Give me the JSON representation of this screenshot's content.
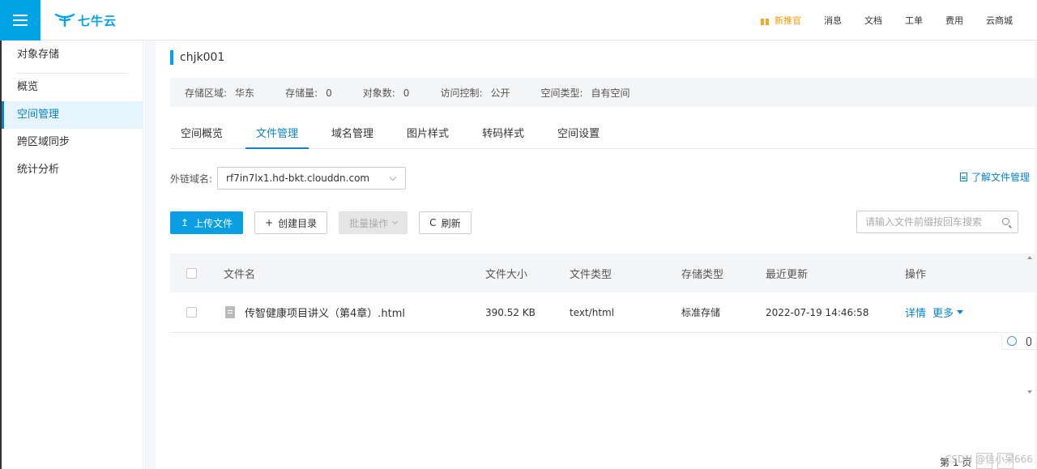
{
  "header": {
    "logo_text": "七牛云",
    "nav": [
      {
        "label": "新推官",
        "highlight": true
      },
      {
        "label": "消息"
      },
      {
        "label": "文档"
      },
      {
        "label": "工单"
      },
      {
        "label": "费用"
      },
      {
        "label": "云商城"
      }
    ]
  },
  "sidebar": {
    "section_title": "对象存储",
    "items": [
      "概览",
      "空间管理",
      "跨区域同步",
      "统计分析"
    ],
    "active_index": 1
  },
  "bucket": {
    "name": "chjk001",
    "info": [
      {
        "label": "存储区域:",
        "value": "华东"
      },
      {
        "label": "存储量:",
        "value": "0"
      },
      {
        "label": "对象数:",
        "value": "0"
      },
      {
        "label": "访问控制:",
        "value": "公开"
      },
      {
        "label": "空间类型:",
        "value": "自有空间"
      }
    ]
  },
  "tabs": [
    "空间概览",
    "文件管理",
    "域名管理",
    "图片样式",
    "转码样式",
    "空间设置"
  ],
  "domain": {
    "label": "外链域名:",
    "value": "rf7in7lx1.hd-bkt.clouddn.com",
    "learn_link": "了解文件管理"
  },
  "toolbar": {
    "upload": "上传文件",
    "upload_icon": "↥",
    "mkdir": "创建目录",
    "mkdir_icon": "+",
    "batch": "批量操作",
    "refresh": "刷新",
    "refresh_icon": "C",
    "search_placeholder": "请输入文件前缀按回车搜索"
  },
  "table": {
    "headers": [
      "文件名",
      "文件大小",
      "文件类型",
      "存储类型",
      "最近更新",
      "操作"
    ],
    "rows": [
      {
        "name": "传智健康项目讲义（第4章）.html",
        "size": "390.52 KB",
        "type": "text/html",
        "storage": "标准存储",
        "updated": "2022-07-19 14:46:58",
        "actions": [
          "详情",
          "更多"
        ]
      }
    ]
  },
  "pager": {
    "label": "第 1 页"
  },
  "watermark": "CSDN @信小呆666",
  "colors": {
    "brand": "#00a4e4",
    "link": "#0a83c9",
    "highlight": "#f39800"
  }
}
